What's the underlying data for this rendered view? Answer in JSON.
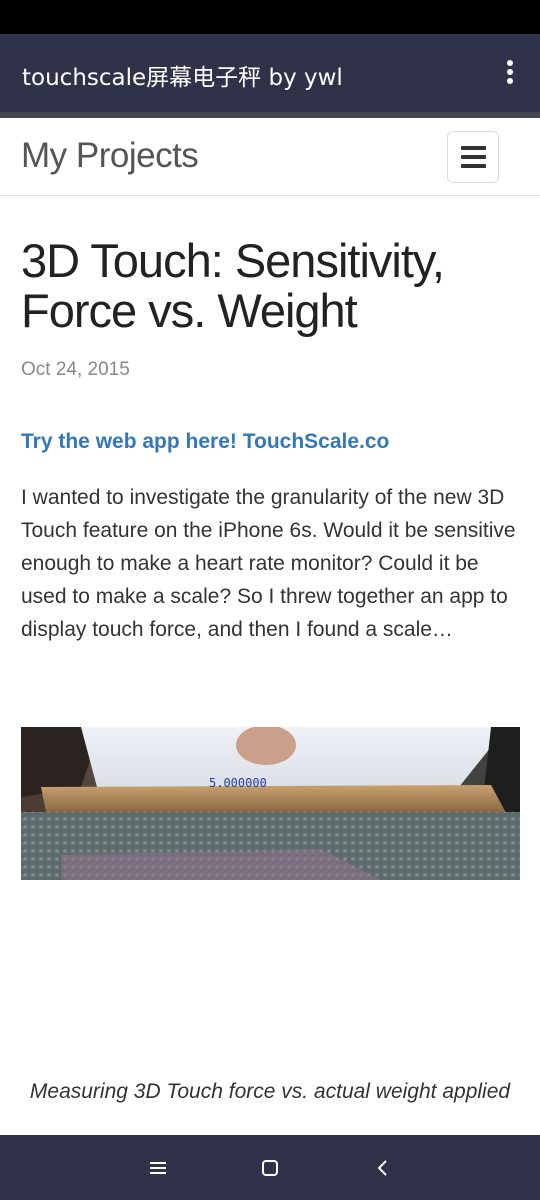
{
  "app_bar": {
    "title": "touchscale屏幕电子秤 by ywl",
    "overflow_icon": "more-vert-icon"
  },
  "site_header": {
    "title": "My Projects",
    "menu_icon": "hamburger-menu-icon"
  },
  "post": {
    "title": "3D Touch: Sensitivity, Force vs. Weight",
    "date": "Oct 24, 2015",
    "web_app_link": "Try the web app here! TouchScale.co",
    "intro": "I wanted to investigate the granularity of the new 3D Touch feature on the iPhone 6s. Would it be sensitive enough to make a heart rate monitor? Could it be used to make a scale? So I threw together an app to display touch force, and then I found a scale…",
    "image_readout": "5.000000",
    "caption": "Measuring 3D Touch force vs. actual weight applied"
  },
  "nav_bar": {
    "recents_icon": "menu-lines-icon",
    "home_icon": "square-home-icon",
    "back_icon": "back-chevron-icon"
  },
  "colors": {
    "app_bar": "#2f3249",
    "link": "#3378bd",
    "text": "#333333"
  }
}
